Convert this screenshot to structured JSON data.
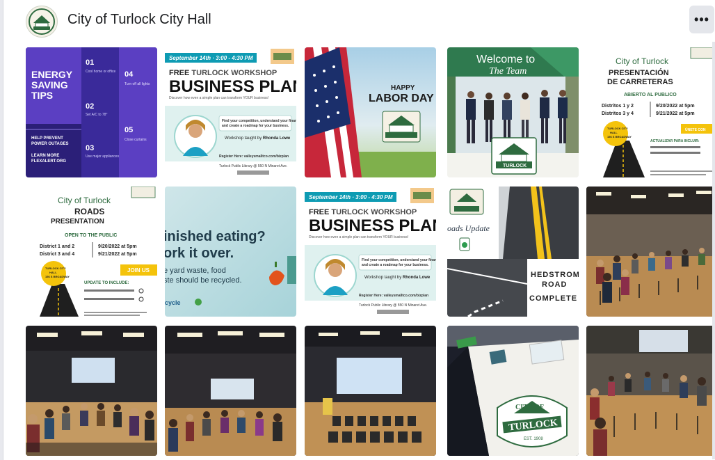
{
  "page": {
    "title": "City of Turlock City Hall",
    "more_label": "•••"
  },
  "logo": {
    "line1": "CITY OF",
    "line2": "TURLOCK",
    "est": "EST. 1908"
  },
  "tiles": {
    "t1": {
      "heading": "ENERGY SAVING TIPS",
      "tips": [
        {
          "n": "01",
          "t": "Cool home or office to 78° overnight or in the morning"
        },
        {
          "n": "02",
          "t": "Set A/C to 78° or higher from 4-9PM"
        },
        {
          "n": "03",
          "t": "Use major appliances before 4PM"
        },
        {
          "n": "04",
          "t": "Turn off all unnecessary lights"
        },
        {
          "n": "05",
          "t": "Close curtains and blinds to prevent loss of cool air"
        }
      ],
      "foot1": "HELP PREVENT POWER OUTAGES",
      "foot2": "LEARN MORE FLEXALERT.ORG"
    },
    "t2": {
      "date": "September 14th · 3:00 - 4:30 PM",
      "free": "FREE",
      "workshop": "TURLOCK WORKSHOP",
      "big": "BUSINESS PLAN",
      "sub": "Discover how even a simple plan can transform YOUR business!",
      "find": "Find your competition, understand your financials and create a roadmap for your business.",
      "taught": "Workshop taught by Rhonda Lowe",
      "register": "Register Here: valleysmalltco.com/bizplan",
      "library": "Turlock Public Library @ 550 N Minaret Ave."
    },
    "t3": {
      "line1": "HAPPY",
      "line2": "LABOR DAY"
    },
    "t4": {
      "line1": "Welcome to",
      "line2": "The Team"
    },
    "t5": {
      "city": "City of Turlock",
      "title1": "PRESENTACIÓN",
      "title2": "DE CARRETERAS",
      "open": "ABIERTO AL PUBLICO",
      "r1a": "Distritos 1 y 2",
      "r1b": "9/20/2022 at 5pm",
      "r2a": "Distritos 3 y 4",
      "r2b": "9/21/2022 at 5pm",
      "hall": "TURLOCK CITY HALL 156 S BROADWAY TURLOCK CA 95380",
      "join": "ÚNETE CON NOSOTROS",
      "upd": "ACTUALIZAR PARA INCLUIR:"
    },
    "t6": {
      "city": "City of Turlock",
      "title1": "ROADS",
      "title2": "PRESENTATION",
      "open": "OPEN TO THE PUBLIC",
      "r1a": "District 1 and 2",
      "r1b": "9/20/2022 at 5pm",
      "r2a": "District 3 and 4",
      "r2b": "9/21/2022 at 5pm",
      "hall": "TURLOCK CITY HALL 156 S BROADWAY TURLOCK CA 95380",
      "join": "JOIN US",
      "upd": "UPDATE TO INCLUDE:"
    },
    "t7": {
      "line1": "inished eating?",
      "line2": "ork it over.",
      "line3": "e yard waste, food",
      "line4": "ste should be recycled.",
      "brand": "cycle"
    },
    "t9": {
      "line1": "oads Update",
      "h1": "HEDSTROM",
      "h2": "ROAD",
      "h3": "COMPLETE"
    }
  }
}
